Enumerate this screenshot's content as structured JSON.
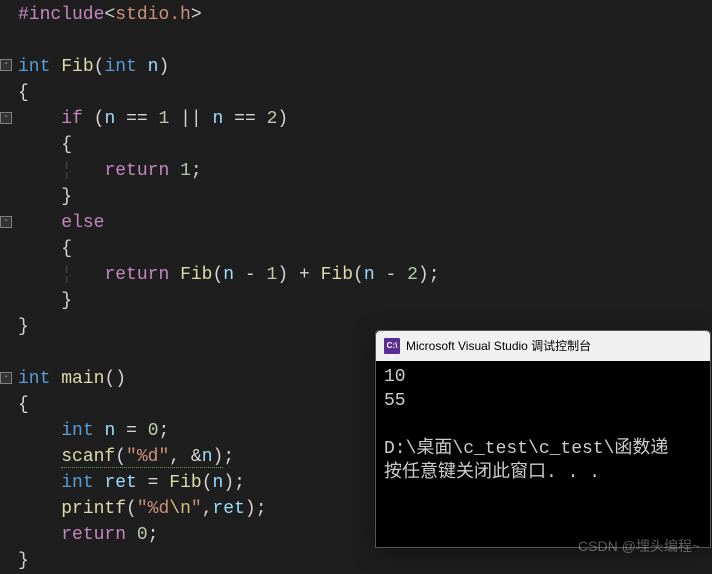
{
  "code": {
    "l1_pre": "#include",
    "l1_file": "stdio.h",
    "l3_type": "int",
    "l3_fn": "Fib",
    "l3_param_type": "int",
    "l3_param": "n",
    "l5_if": "if",
    "l5_cond_var1": "n",
    "l5_cond_eq1": "==",
    "l5_cond_val1": "1",
    "l5_cond_or": "||",
    "l5_cond_var2": "n",
    "l5_cond_eq2": "==",
    "l5_cond_val2": "2",
    "l7_return": "return",
    "l7_val": "1",
    "l9_else": "else",
    "l11_return": "return",
    "l11_fn1": "Fib",
    "l11_var1": "n",
    "l11_op1": "-",
    "l11_v1": "1",
    "l11_plus": "+",
    "l11_fn2": "Fib",
    "l11_var2": "n",
    "l11_op2": "-",
    "l11_v2": "2",
    "l15_type": "int",
    "l15_fn": "main",
    "l17_type": "int",
    "l17_var": "n",
    "l17_eq": "=",
    "l17_val": "0",
    "l18_fn": "scanf",
    "l18_fmt": "\"%d\"",
    "l18_amp": "&n",
    "l19_type": "int",
    "l19_var": "ret",
    "l19_eq": "=",
    "l19_fn": "Fib",
    "l19_arg": "n",
    "l20_fn": "printf",
    "l20_fmt_open": "\"",
    "l20_fmt_d": "%d",
    "l20_fmt_esc": "\\n",
    "l20_fmt_close": "\"",
    "l20_arg": "ret",
    "l21_return": "return",
    "l21_val": "0"
  },
  "console": {
    "title": "Microsoft Visual Studio 调试控制台",
    "icon_text": "C:\\",
    "line1": "10",
    "line2": "55",
    "line3": "",
    "line4": "D:\\桌面\\c_test\\c_test\\函数递",
    "line5": "按任意键关闭此窗口. . ."
  },
  "watermark": "CSDN @埋头编程~"
}
